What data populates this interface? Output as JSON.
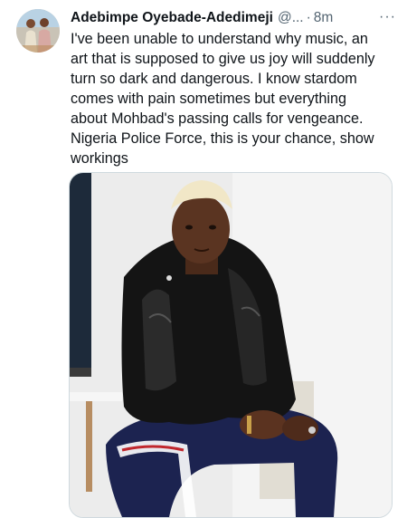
{
  "tweet": {
    "author_name": "Adebimpe Oyebade-Adedimeji",
    "handle": "@...",
    "separator": "·",
    "time": "8m",
    "more_icon": "more-horizontal-icon",
    "text": "I've been unable to understand why music, an\nart that is supposed to give us joy will suddenly\nturn so dark and dangerous. I know stardom\ncomes with pain sometimes but everything\nabout Mohbad's passing calls for vengeance.\nNigeria Police Force, this is your chance, show\nworkings"
  },
  "colors": {
    "text_primary": "#0f1419",
    "text_secondary": "#536471",
    "border": "#cfd9de"
  }
}
